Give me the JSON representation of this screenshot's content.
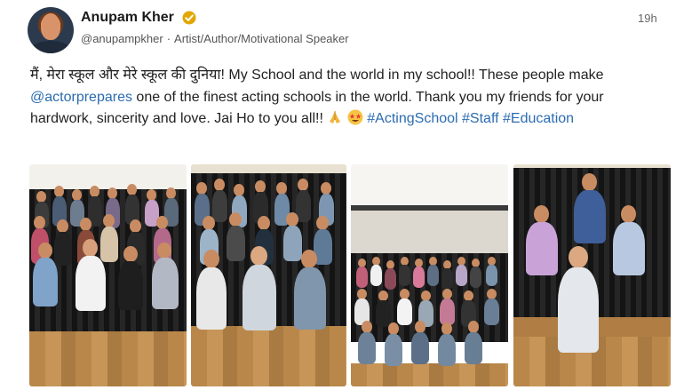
{
  "author": {
    "name": "Anupam Kher",
    "handle": "@anupampkher",
    "bio": "Artist/Author/Motivational Speaker",
    "separator": "·",
    "timestamp": "19h",
    "avatar_icon": "user-avatar",
    "verified_icon": "verified-badge-icon",
    "verified_color": "#e0a800"
  },
  "post": {
    "text_1": "मैं, मेरा स्कूल और मेरे स्कूल की दुनिया! My School and the world in my school!! These people make ",
    "mention": "@actorprepares",
    "text_2": " one of the finest acting schools in the world. Thank you my friends for your hardwork, sincerity and love. Jai Ho to you all!! ",
    "emoji_1": "folded-hands-emoji",
    "emoji_2": "star-struck-emoji",
    "hashtag_1": "#ActingSchool",
    "hashtag_2": "#Staff",
    "hashtag_3": "#Education",
    "link_color": "#2b6cb0"
  },
  "photos": [
    {
      "name": "group-photo-1"
    },
    {
      "name": "group-photo-2"
    },
    {
      "name": "group-photo-3"
    },
    {
      "name": "group-photo-4"
    }
  ]
}
